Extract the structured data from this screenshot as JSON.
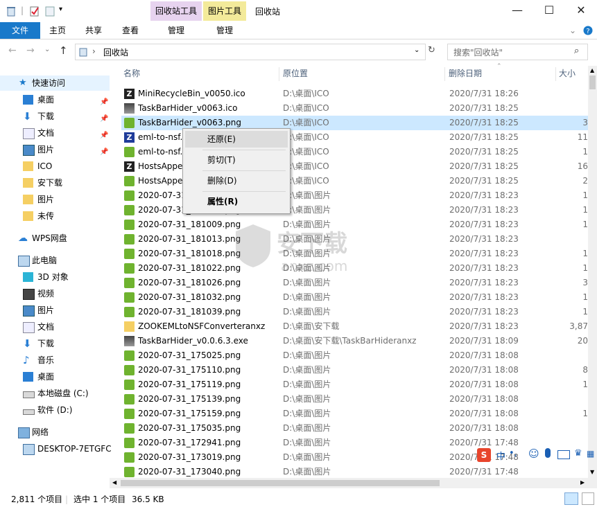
{
  "window": {
    "title": "回收站",
    "contextual_tabs": [
      "回收站工具",
      "图片工具"
    ],
    "minimize": "—",
    "maximize": "☐",
    "close": "✕"
  },
  "ribbon": {
    "file": "文件",
    "tabs": [
      "主页",
      "共享",
      "查看"
    ],
    "manage1": "管理",
    "manage2": "管理"
  },
  "address": {
    "path": "回收站",
    "search_placeholder": "搜索\"回收站\""
  },
  "nav": {
    "quick_access": "快速访问",
    "quick_items": [
      "桌面",
      "下载",
      "文档",
      "图片",
      "ICO",
      "安下载",
      "图片",
      "未传"
    ],
    "wps": "WPS网盘",
    "this_pc": "此电脑",
    "pc_items": [
      "3D 对象",
      "视频",
      "图片",
      "文档",
      "下载",
      "音乐",
      "桌面",
      "本地磁盘 (C:)",
      "软件 (D:)"
    ],
    "network": "网络",
    "network_items": [
      "DESKTOP-7ETGFC"
    ]
  },
  "columns": {
    "name": "名称",
    "location": "原位置",
    "date": "删除日期",
    "size": "大小"
  },
  "rows": [
    {
      "name": "MiniRecycleBin_v0050.ico",
      "loc": "D:\\桌面\\ICO",
      "date": "2020/7/31 18:26",
      "size": "",
      "icon": "z"
    },
    {
      "name": "TaskBarHider_v0063.ico",
      "loc": "D:\\桌面\\ICO",
      "date": "2020/7/31 18:25",
      "size": "",
      "icon": "exe"
    },
    {
      "name": "TaskBarHider_v0063.png",
      "loc": "D:\\桌面\\ICO",
      "date": "2020/7/31 18:25",
      "size": "3",
      "icon": "png"
    },
    {
      "name": "eml-to-nsf.ico",
      "loc": "D:\\桌面\\ICO",
      "date": "2020/7/31 18:25",
      "size": "11",
      "icon": "zb"
    },
    {
      "name": "eml-to-nsf.png",
      "loc": "D:\\桌面\\ICO",
      "date": "2020/7/31 18:25",
      "size": "1",
      "icon": "png"
    },
    {
      "name": "HostsAppender.ico",
      "loc": "D:\\桌面\\ICO",
      "date": "2020/7/31 18:25",
      "size": "16",
      "icon": "z"
    },
    {
      "name": "HostsAppender.png",
      "loc": "D:\\桌面\\ICO",
      "date": "2020/7/31 18:25",
      "size": "2",
      "icon": "png"
    },
    {
      "name": "2020-07-31_181002.png",
      "loc": "D:\\桌面\\图片",
      "date": "2020/7/31 18:23",
      "size": "1",
      "icon": "png"
    },
    {
      "name": "2020-07-31_181005.png",
      "loc": "D:\\桌面\\图片",
      "date": "2020/7/31 18:23",
      "size": "1",
      "icon": "png"
    },
    {
      "name": "2020-07-31_181009.png",
      "loc": "D:\\桌面\\图片",
      "date": "2020/7/31 18:23",
      "size": "1",
      "icon": "png"
    },
    {
      "name": "2020-07-31_181013.png",
      "loc": "D:\\桌面\\图片",
      "date": "2020/7/31 18:23",
      "size": "",
      "icon": "png"
    },
    {
      "name": "2020-07-31_181018.png",
      "loc": "D:\\桌面\\图片",
      "date": "2020/7/31 18:23",
      "size": "1",
      "icon": "png"
    },
    {
      "name": "2020-07-31_181022.png",
      "loc": "D:\\桌面\\图片",
      "date": "2020/7/31 18:23",
      "size": "1",
      "icon": "png"
    },
    {
      "name": "2020-07-31_181026.png",
      "loc": "D:\\桌面\\图片",
      "date": "2020/7/31 18:23",
      "size": "3",
      "icon": "png"
    },
    {
      "name": "2020-07-31_181032.png",
      "loc": "D:\\桌面\\图片",
      "date": "2020/7/31 18:23",
      "size": "1",
      "icon": "png"
    },
    {
      "name": "2020-07-31_181039.png",
      "loc": "D:\\桌面\\图片",
      "date": "2020/7/31 18:23",
      "size": "1",
      "icon": "png"
    },
    {
      "name": "ZOOKEMLtoNSFConverteranxz",
      "loc": "D:\\桌面\\安下载",
      "date": "2020/7/31 18:23",
      "size": "3,87",
      "icon": "folder"
    },
    {
      "name": "TaskBarHider_v0.0.6.3.exe",
      "loc": "D:\\桌面\\安下载\\TaskBarHideranxz",
      "date": "2020/7/31 18:09",
      "size": "20",
      "icon": "exe"
    },
    {
      "name": "2020-07-31_175025.png",
      "loc": "D:\\桌面\\图片",
      "date": "2020/7/31 18:08",
      "size": "",
      "icon": "png"
    },
    {
      "name": "2020-07-31_175110.png",
      "loc": "D:\\桌面\\图片",
      "date": "2020/7/31 18:08",
      "size": "8",
      "icon": "png"
    },
    {
      "name": "2020-07-31_175119.png",
      "loc": "D:\\桌面\\图片",
      "date": "2020/7/31 18:08",
      "size": "1",
      "icon": "png"
    },
    {
      "name": "2020-07-31_175139.png",
      "loc": "D:\\桌面\\图片",
      "date": "2020/7/31 18:08",
      "size": "",
      "icon": "png"
    },
    {
      "name": "2020-07-31_175159.png",
      "loc": "D:\\桌面\\图片",
      "date": "2020/7/31 18:08",
      "size": "1",
      "icon": "png"
    },
    {
      "name": "2020-07-31_175035.png",
      "loc": "D:\\桌面\\图片",
      "date": "2020/7/31 18:08",
      "size": "",
      "icon": "png"
    },
    {
      "name": "2020-07-31_172941.png",
      "loc": "D:\\桌面\\图片",
      "date": "2020/7/31 17:48",
      "size": "",
      "icon": "png"
    },
    {
      "name": "2020-07-31_173019.png",
      "loc": "D:\\桌面\\图片",
      "date": "2020/7/31 17:48",
      "size": "",
      "icon": "png"
    },
    {
      "name": "2020-07-31_173040.png",
      "loc": "D:\\桌面\\图片",
      "date": "2020/7/31 17:48",
      "size": "",
      "icon": "png"
    }
  ],
  "context_menu": {
    "restore": "还原(E)",
    "cut": "剪切(T)",
    "delete": "删除(D)",
    "properties": "属性(R)"
  },
  "status": {
    "count": "2,811 个项目",
    "selected": "选中 1 个项目",
    "size": "36.5 KB"
  },
  "watermark": {
    "text": "安下载",
    "sub": "anxz.com"
  },
  "ime": {
    "label": "中"
  }
}
